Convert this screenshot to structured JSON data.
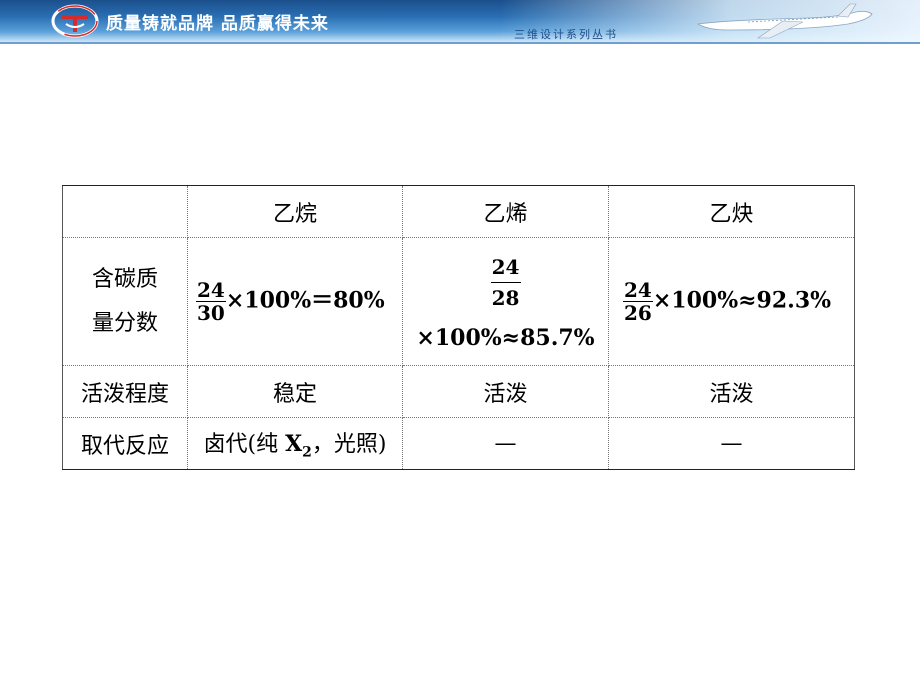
{
  "header": {
    "slogan": "质量铸就品牌 品质赢得未来",
    "series": "三维设计系列丛书",
    "colors": {
      "banner_dark": "#1b4f8c",
      "banner_light": "#5aa0da"
    }
  },
  "table": {
    "columns": [
      "",
      "乙烷",
      "乙烯",
      "乙炔"
    ],
    "rows": [
      {
        "label_line1": "含碳质",
        "label_line2": "量分数",
        "ethane": {
          "num": "24",
          "den": "30",
          "rest": "×100%＝80%"
        },
        "ethene": {
          "num": "24",
          "den": "28",
          "rest": "×100%≈85.7%"
        },
        "ethyne": {
          "num": "24",
          "den": "26",
          "rest": "×100%≈92.3%"
        }
      },
      {
        "label": "活泼程度",
        "cells": [
          "稳定",
          "活泼",
          "活泼"
        ]
      },
      {
        "label": "取代反应",
        "ethane_prefix": "卤代(纯 ",
        "ethane_x": "X",
        "ethane_sub": "2",
        "ethane_suffix": "，光照)",
        "cells": [
          "—",
          "—"
        ]
      }
    ]
  }
}
